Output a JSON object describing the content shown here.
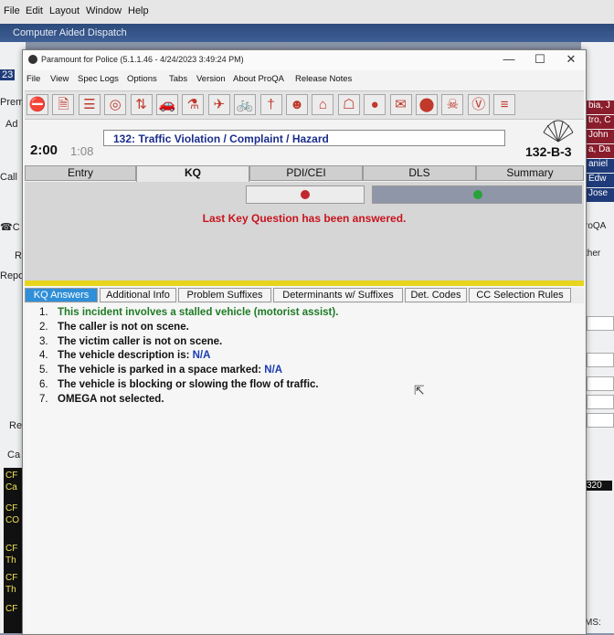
{
  "desktop_menu": {
    "file": "File",
    "edit": "Edit",
    "layout": "Layout",
    "window": "Window",
    "help": "Help"
  },
  "cad_title": "Computer Aided Dispatch",
  "left_labels": [
    "23",
    "Prem",
    "Ad",
    "Call",
    "☎C",
    "R",
    "Repo",
    "Re",
    "Ca"
  ],
  "left_cards": [
    {
      "l1": "CF",
      "l2": "Ca"
    },
    {
      "l1": "CF",
      "l2": "CO"
    },
    {
      "l1": "CF",
      "l2": "Th"
    },
    {
      "l1": "CF",
      "l2": "Th"
    },
    {
      "l1": "CF",
      "l2": ""
    }
  ],
  "right_names": [
    "bia, J",
    "tro, C",
    "John",
    "a, Da",
    "aniel",
    "Edw",
    "Jose"
  ],
  "right_texts": {
    "proqa": "roQA",
    "other": "ther",
    "num": "320",
    "ms": "MS:"
  },
  "window": {
    "title": "Paramount for Police (5.1.1.46 - 4/24/2023 3:49:24 PM)",
    "min": "—",
    "max": "☐",
    "close": "✕",
    "menu": [
      "File",
      "View",
      "Spec Logs",
      "Options",
      "Tabs",
      "Version",
      "About ProQA",
      "Release Notes"
    ]
  },
  "toolbar_icons": [
    {
      "name": "no-entry-icon",
      "glyph": "⛔"
    },
    {
      "name": "document-icon",
      "glyph": "🗎"
    },
    {
      "name": "list-document-icon",
      "glyph": "☰"
    },
    {
      "name": "target-icon",
      "glyph": "◎"
    },
    {
      "name": "traffic-arrows-icon",
      "glyph": "⇅"
    },
    {
      "name": "car-icon",
      "glyph": "🚗"
    },
    {
      "name": "flask-icon",
      "glyph": "⚗"
    },
    {
      "name": "airplane-icon",
      "glyph": "✈"
    },
    {
      "name": "bicycle-icon",
      "glyph": "🚲"
    },
    {
      "name": "person-icon",
      "glyph": "†"
    },
    {
      "name": "officer-icon",
      "glyph": "☻"
    },
    {
      "name": "hat-icon",
      "glyph": "⌂"
    },
    {
      "name": "bank-icon",
      "glyph": "☖"
    },
    {
      "name": "bomb-icon",
      "glyph": "●"
    },
    {
      "name": "mail-icon",
      "glyph": "✉"
    },
    {
      "name": "stop-icon",
      "glyph": "⬤"
    },
    {
      "name": "skull-icon",
      "glyph": "☠"
    },
    {
      "name": "vice-badge-icon",
      "glyph": "Ⓥ"
    },
    {
      "name": "traffic-light-icon",
      "glyph": "≡"
    }
  ],
  "protocol": "132:  Traffic Violation / Complaint / Hazard",
  "timer": "2:00",
  "timer_secondary": "1:08",
  "determinant_code": "132-B-3",
  "tabs": [
    "Entry",
    "KQ",
    "PDI/CEI",
    "DLS",
    "Summary"
  ],
  "active_tab": "KQ",
  "kq_message": "Last Key Question has been answered.",
  "subtabs": [
    "KQ Answers",
    "Additional Info",
    "Problem Suffixes",
    "Determinants w/ Suffixes",
    "Det. Codes",
    "CC Selection Rules"
  ],
  "answers": [
    {
      "num": "1.",
      "text": "This incident involves a stalled vehicle (motorist assist).",
      "value": "",
      "green": true
    },
    {
      "num": "2.",
      "text": "The caller is not on scene.",
      "value": "",
      "green": false
    },
    {
      "num": "3.",
      "text": "The victim caller is not on scene.",
      "value": "",
      "green": false
    },
    {
      "num": "4.",
      "text": "The vehicle description is: ",
      "value": "N/A",
      "green": false
    },
    {
      "num": "5.",
      "text": "The vehicle is parked in a space marked: ",
      "value": "N/A",
      "green": false
    },
    {
      "num": "6.",
      "text": "The vehicle is blocking or slowing the flow of traffic.",
      "value": "",
      "green": false
    },
    {
      "num": "7.",
      "text": "OMEGA not selected.",
      "value": "",
      "green": false
    }
  ],
  "colors": {
    "protocol_text": "#1a2d8c",
    "message_red": "#c8141e",
    "answer_green": "#1e7b24",
    "value_blue": "#1a3bb0",
    "active_subtab": "#2f8fd8",
    "separator_yellow": "#e6d51c"
  }
}
